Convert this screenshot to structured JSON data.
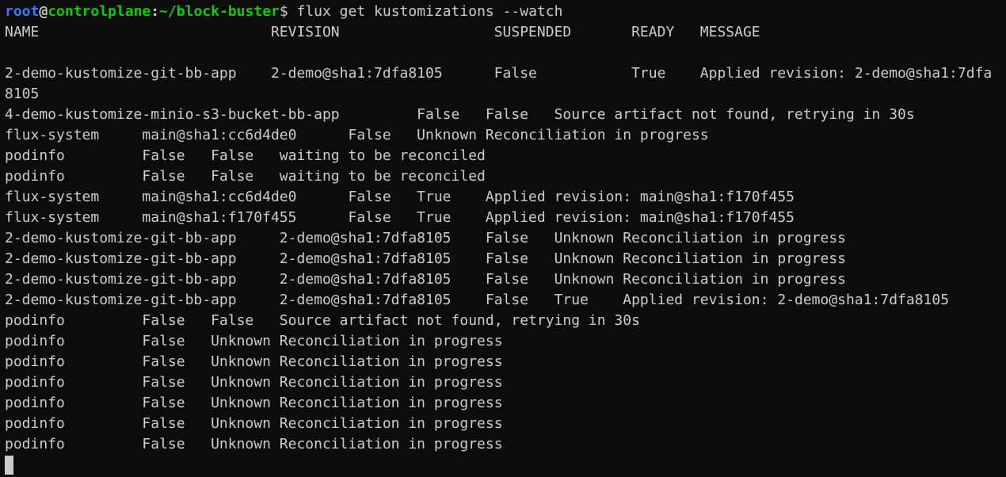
{
  "prompt": {
    "user": "root",
    "at": "@",
    "host": "controlplane",
    "colon": ":",
    "path": "~/block-buster",
    "dollar": "$",
    "command": " flux get kustomizations --watch"
  },
  "output": {
    "lines": [
      "NAME                           REVISION                  SUSPENDED       READY   MESSAGE",
      "",
      "2-demo-kustomize-git-bb-app    2-demo@sha1:7dfa8105      False           True    Applied revision: 2-demo@sha1:7dfa",
      "8105",
      "4-demo-kustomize-minio-s3-bucket-bb-app         False   False   Source artifact not found, retrying in 30s",
      "flux-system     main@sha1:cc6d4de0      False   Unknown Reconciliation in progress",
      "podinfo         False   False   waiting to be reconciled",
      "podinfo         False   False   waiting to be reconciled",
      "flux-system     main@sha1:cc6d4de0      False   True    Applied revision: main@sha1:f170f455",
      "flux-system     main@sha1:f170f455      False   True    Applied revision: main@sha1:f170f455",
      "2-demo-kustomize-git-bb-app     2-demo@sha1:7dfa8105    False   Unknown Reconciliation in progress",
      "2-demo-kustomize-git-bb-app     2-demo@sha1:7dfa8105    False   Unknown Reconciliation in progress",
      "2-demo-kustomize-git-bb-app     2-demo@sha1:7dfa8105    False   Unknown Reconciliation in progress",
      "2-demo-kustomize-git-bb-app     2-demo@sha1:7dfa8105    False   True    Applied revision: 2-demo@sha1:7dfa8105",
      "podinfo         False   False   Source artifact not found, retrying in 30s",
      "podinfo         False   Unknown Reconciliation in progress",
      "podinfo         False   Unknown Reconciliation in progress",
      "podinfo         False   Unknown Reconciliation in progress",
      "podinfo         False   Unknown Reconciliation in progress",
      "podinfo         False   Unknown Reconciliation in progress",
      "podinfo         False   Unknown Reconciliation in progress"
    ]
  },
  "colors": {
    "background": "#0c0c0c",
    "foreground": "#cccccc",
    "prompt_user": "#3b78ff",
    "prompt_host": "#16c60c"
  }
}
